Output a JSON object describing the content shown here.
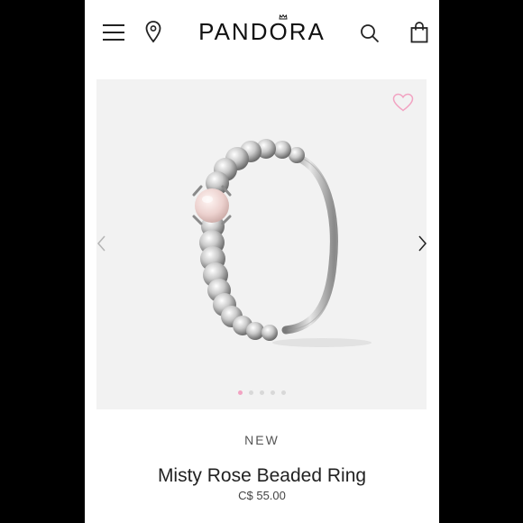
{
  "header": {
    "brand": "PANDORA",
    "icons": [
      "menu-icon",
      "location-pin-icon",
      "search-icon",
      "shopping-bag-icon"
    ]
  },
  "gallery": {
    "image": "silver-beaded-ring-with-pink-stone",
    "total_images": 5,
    "active_index": 0,
    "wishlist_icon": "heart-icon",
    "accent_color": "#f2a3c2"
  },
  "product": {
    "badge": "NEW",
    "name": "Misty Rose Beaded Ring",
    "price": "C$ 55.00"
  }
}
